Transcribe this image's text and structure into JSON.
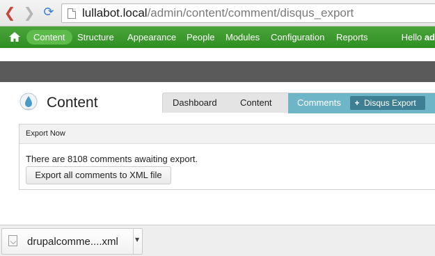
{
  "browser": {
    "url_host": "lullabot.local",
    "url_path": "/admin/content/comment/disqus_export"
  },
  "toolbar": {
    "items": [
      "Content",
      "Structure",
      "Appearance",
      "People",
      "Modules",
      "Configuration",
      "Reports"
    ],
    "active": "Content",
    "greeting": "Hello",
    "user_fragment": "ad"
  },
  "page": {
    "title": "Content",
    "tabs": [
      "Dashboard",
      "Content",
      "Comments"
    ],
    "active_tab": "Comments",
    "action_label": "Disqus Export",
    "action_icon": "+"
  },
  "panel": {
    "title": "Export Now",
    "message": "There are 8108 comments awaiting export.",
    "button_label": "Export all comments to XML file"
  },
  "download": {
    "filename": "drupalcomme....xml"
  },
  "colors": {
    "toolbar_green": "#3c9a2e",
    "active_tab": "#6fb5c8",
    "action_button": "#3f7f93"
  }
}
